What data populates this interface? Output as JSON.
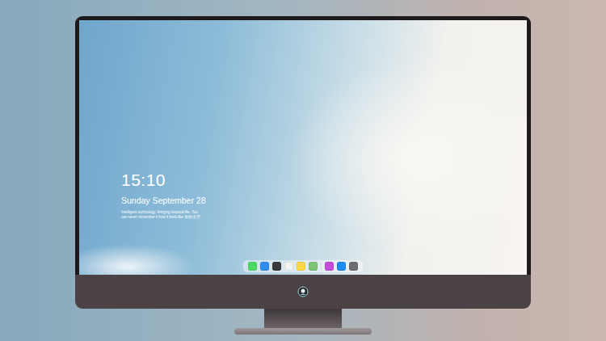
{
  "desktop": {
    "time": "15:10",
    "date": "Sunday September 28",
    "caption": [
      "Intelligent technology, bringing inspired life. You",
      "can never remember it how it feels like 你的名字"
    ]
  },
  "dock": {
    "items": [
      {
        "kind": "app",
        "color": "#4cd964"
      },
      {
        "kind": "app",
        "color": "#2f8cf0"
      },
      {
        "kind": "app",
        "color": "#3a3a3c"
      },
      {
        "kind": "app",
        "color": "#f2f2f2"
      },
      {
        "kind": "app",
        "color": "#ffd84a"
      },
      {
        "kind": "app",
        "color": "#7cc576"
      },
      {
        "kind": "separator",
        "color": "#d9d9d9"
      },
      {
        "kind": "app",
        "color": "#c64bd8"
      },
      {
        "kind": "app",
        "color": "#1e8cf5"
      },
      {
        "kind": "app",
        "color": "#6e6e73"
      }
    ]
  }
}
